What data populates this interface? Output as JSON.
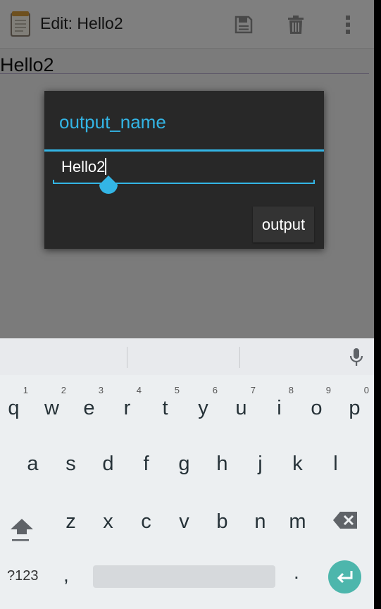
{
  "actionbar": {
    "title": "Edit: Hello2",
    "icons": {
      "app": "notepad-icon",
      "save": "save-icon",
      "delete": "delete-icon",
      "overflow": "more-vert-icon"
    }
  },
  "editor": {
    "text": "Hello2"
  },
  "dialog": {
    "title": "output_name",
    "input_value": "Hello2",
    "button_label": "output"
  },
  "keyboard": {
    "row1": [
      {
        "key": "q",
        "hint": "1"
      },
      {
        "key": "w",
        "hint": "2"
      },
      {
        "key": "e",
        "hint": "3"
      },
      {
        "key": "r",
        "hint": "4"
      },
      {
        "key": "t",
        "hint": "5"
      },
      {
        "key": "y",
        "hint": "6"
      },
      {
        "key": "u",
        "hint": "7"
      },
      {
        "key": "i",
        "hint": "8"
      },
      {
        "key": "o",
        "hint": "9"
      },
      {
        "key": "p",
        "hint": "0"
      }
    ],
    "row2": [
      "a",
      "s",
      "d",
      "f",
      "g",
      "h",
      "j",
      "k",
      "l"
    ],
    "row3": [
      "z",
      "x",
      "c",
      "v",
      "b",
      "n",
      "m"
    ],
    "symbols_label": "?123",
    "comma": ",",
    "period": ".",
    "icons": {
      "shift": "shift-icon",
      "backspace": "backspace-icon",
      "enter": "enter-icon",
      "mic": "mic-icon"
    }
  },
  "colors": {
    "accent": "#33b5e5",
    "dialog_bg": "#282828",
    "enter_key": "#4db6ac"
  }
}
